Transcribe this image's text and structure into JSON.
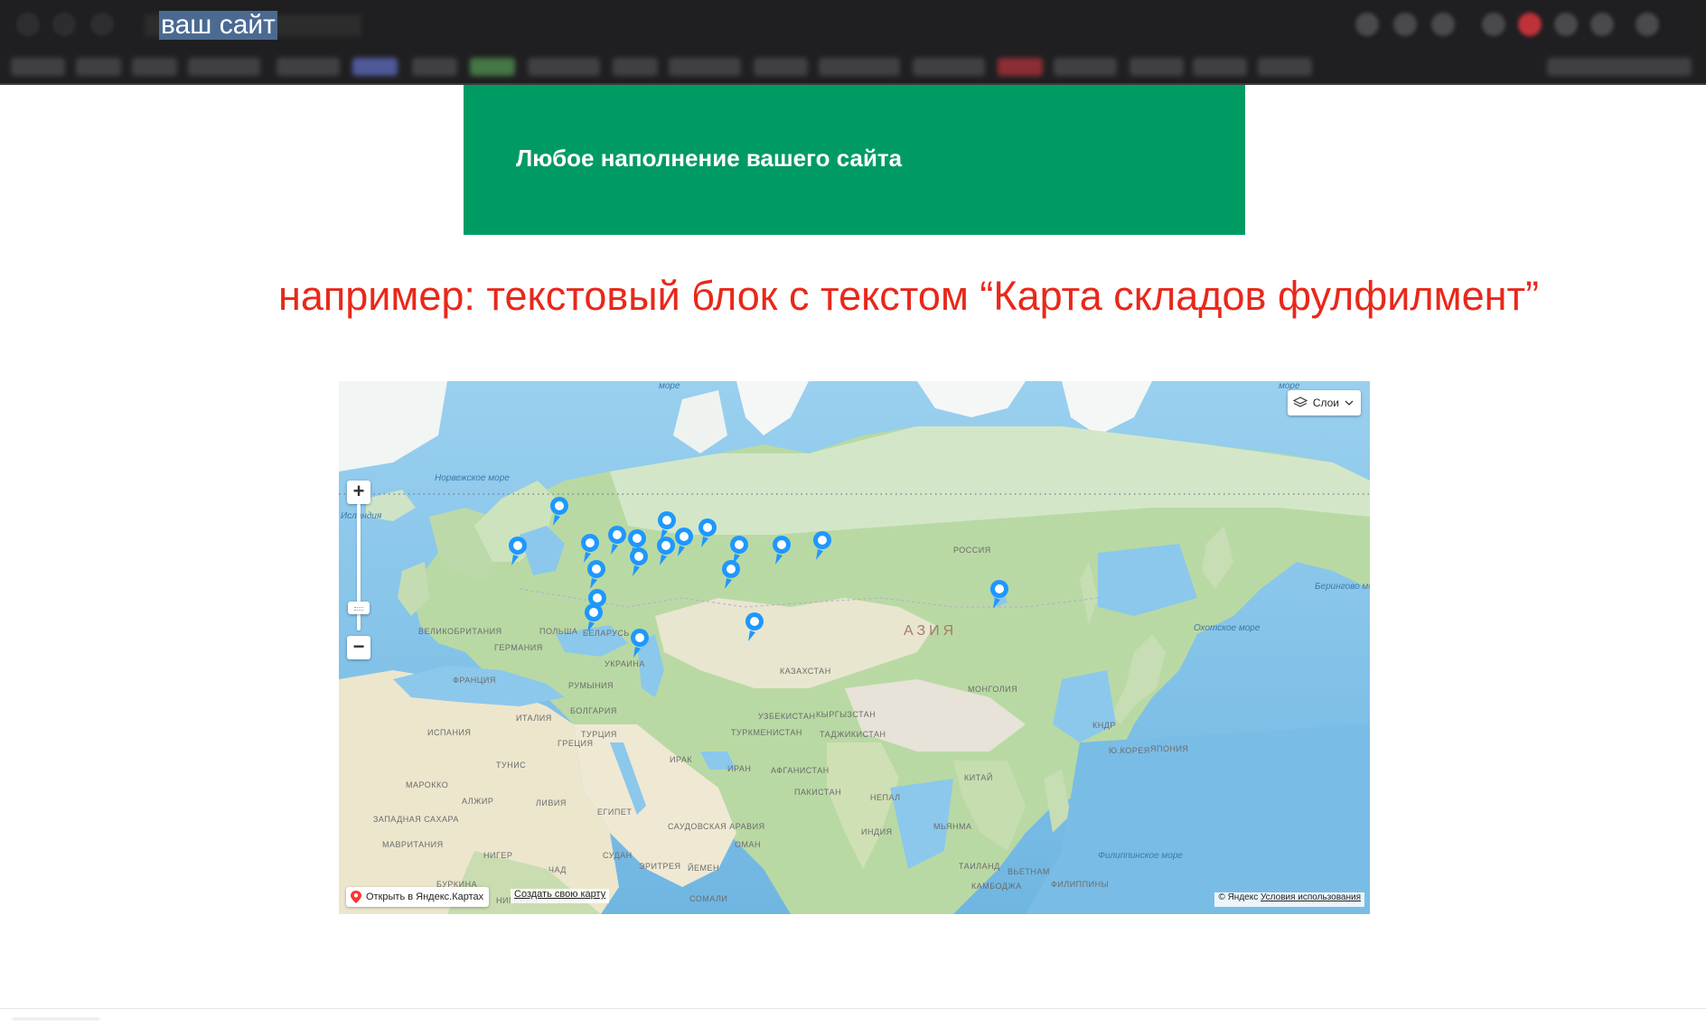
{
  "browser": {
    "selected_address_text": "ваш сайт"
  },
  "hero": {
    "text": "Любое наполнение вашего сайта"
  },
  "note": {
    "text": "например: текстовый блок с текстом “Карта складов фулфилмент”"
  },
  "map": {
    "layers_label": "Слои",
    "zoom_in_label": "+",
    "zoom_out_label": "−",
    "open_label": "Открыть в Яндекс.Картах",
    "create_label": "Создать свою карту",
    "copyright_label": "© Яндекс",
    "terms_label": "Условия использования",
    "labels": {
      "norwegian_sea": "Норвежское море",
      "iceland": "Исландия",
      "bering_sea": "Берингово море",
      "okhotsk_sea": "Охотское море",
      "philippine_sea": "Филиппинское море",
      "asia": "АЗИЯ",
      "russia": "РОССИЯ",
      "kazakhstan": "КАЗАХСТАН",
      "mongolia": "МОНГОЛИЯ",
      "china": "КИТАЙ",
      "uzbekistan": "УЗБЕКИСТАН",
      "kyrgyzstan": "КЫРГЫЗСТАН",
      "tajikistan": "ТАДЖИКИСТАН",
      "turkmenistan": "ТУРКМЕНИСТАН",
      "afghanistan": "АФГАНИСТАН",
      "pakistan": "ПАКИСТАН",
      "iran": "ИРАН",
      "iraq": "ИРАК",
      "turkey": "ТУРЦИЯ",
      "ukraine": "УКРАИНА",
      "poland": "ПОЛЬША",
      "belarus": "БЕЛАРУСЬ",
      "germany": "ГЕРМАНИЯ",
      "france": "ФРАНЦИЯ",
      "spain": "ИСПАНИЯ",
      "uk": "ВЕЛИКОБРИТАНИЯ",
      "romania": "РУМЫНИЯ",
      "bulgaria": "БОЛГАРИЯ",
      "greece": "ГРЕЦИЯ",
      "italy": "ИТАЛИЯ",
      "tunisia": "ТУНИС",
      "morocco": "МАРОККО",
      "algeria": "АЛЖИР",
      "libya": "ЛИВИЯ",
      "egypt": "ЕГИПЕТ",
      "western_sahara": "ЗАПАДНАЯ САХАРА",
      "mauritania": "МАВРИТАНИЯ",
      "niger": "НИГЕР",
      "chad": "ЧАД",
      "sudan": "СУДАН",
      "eritrea": "ЭРИТРЕЯ",
      "burkina": "БУРКИНА",
      "nigeria": "НИГЕРИЯ",
      "somalia": "СОМАЛИ",
      "saudi": "САУДОВСКАЯ АРАВИЯ",
      "yemen": "ЙЕМЕН",
      "oman": "ОМАН",
      "india": "ИНДИЯ",
      "nepal": "НЕПАЛ",
      "myanmar": "МЬЯНМА",
      "thailand": "ТАИЛАНД",
      "vietnam": "ВЬЕТНАМ",
      "cambodia": "КАМБОДЖА",
      "philippines": "ФИЛИППИНЫ",
      "japan": "ЯПОНИЯ",
      "south_korea": "Ю.КОРЕЯ",
      "north_korea": "КНДР",
      "more_top": "море",
      "more_top2": "море"
    }
  }
}
